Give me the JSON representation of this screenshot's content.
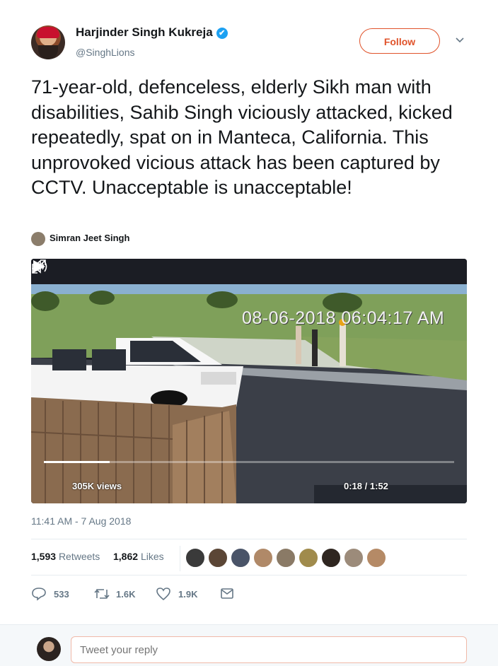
{
  "author": {
    "name": "Harjinder Singh Kukreja",
    "handle": "@SinghLions",
    "verified_icon": "✔",
    "follow_label": "Follow"
  },
  "tweet": {
    "text": "71-year-old, defenceless, elderly Sikh man with disabilities, Sahib Singh viciously attacked, kicked repeatedly, spat on in Manteca, California. This unprovoked vicious attack has been captured by CCTV. Unacceptable is unacceptable!",
    "tagged_user": "Simran Jeet Singh",
    "timestamp": "11:41 AM - 7 Aug 2018"
  },
  "video": {
    "cctv_timestamp": "08-06-2018 06:04:17 AM",
    "views": "305K views",
    "time": "0:18 / 1:52",
    "progress": 0.16
  },
  "stats": {
    "retweets_count": "1,593",
    "retweets_label": "Retweets",
    "likes_count": "1,862",
    "likes_label": "Likes"
  },
  "actions": {
    "replies": "533",
    "retweets": "1.6K",
    "likes": "1.9K"
  },
  "reply": {
    "placeholder": "Tweet your reply"
  },
  "colors": {
    "accent": "#e0532b",
    "verified": "#1da1f2",
    "muted": "#657786"
  }
}
